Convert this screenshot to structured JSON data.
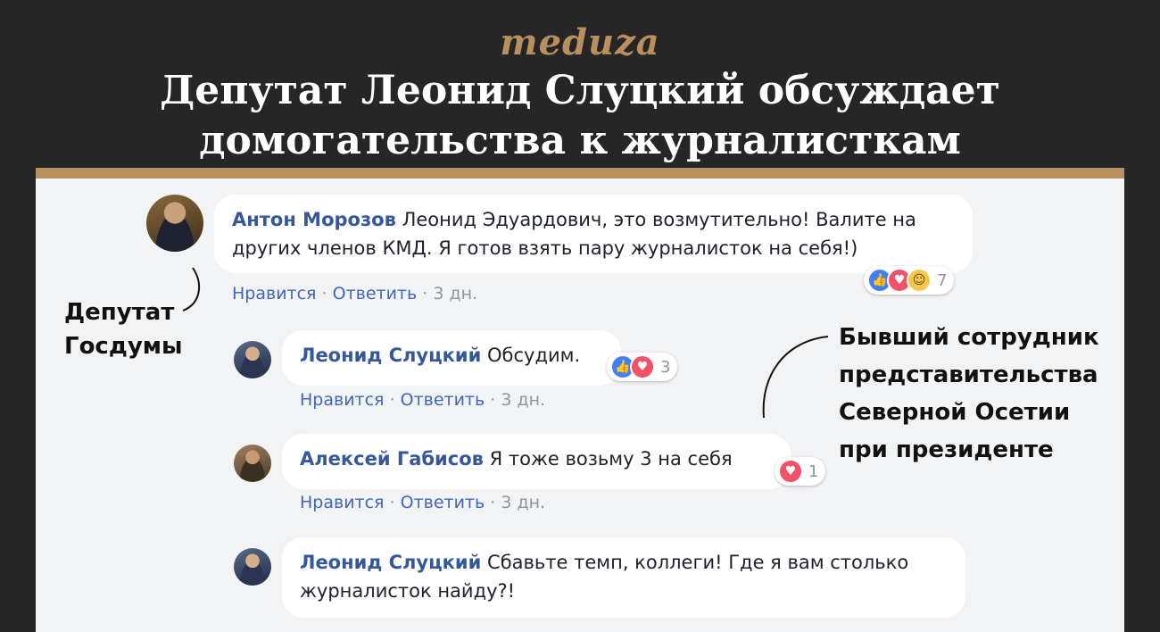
{
  "brand": "meduza",
  "headline": "Депутат Леонид Слуцкий обсуждает домогательства к журналисткам",
  "annotations": {
    "left": "Депутат Госдумы",
    "right": "Бывший сотрудник представительства Северной Осетии при президенте"
  },
  "comments": [
    {
      "author": "Антон Морозов",
      "text": "Леонид Эдуардович, это возмутительно! Валите на других членов КМД. Я готов взять пару журналисток на себя!)",
      "like": "Нравится",
      "reply": "Ответить",
      "time": "3 дн.",
      "reactions": [
        "like-icon",
        "love-icon",
        "haha-icon"
      ],
      "reaction_count": "7"
    },
    {
      "author": "Леонид Слуцкий",
      "text": "Обсудим.",
      "like": "Нравится",
      "reply": "Ответить",
      "time": "3 дн.",
      "reactions": [
        "like-icon",
        "love-icon"
      ],
      "reaction_count": "3"
    },
    {
      "author": "Алексей Габисов",
      "text": "Я тоже возьму 3 на себя",
      "like": "Нравится",
      "reply": "Ответить",
      "time": "3 дн.",
      "reactions": [
        "love-icon"
      ],
      "reaction_count": "1"
    },
    {
      "author": "Леонид Слуцкий",
      "text": "Сбавьте темп, коллеги! Где я вам столько журналисток найду?!"
    }
  ],
  "colors": {
    "background": "#272626",
    "accent": "#b88f5e",
    "card": "#f2f3f5",
    "name": "#365899",
    "link": "#4267b2",
    "meta": "#90949c"
  }
}
